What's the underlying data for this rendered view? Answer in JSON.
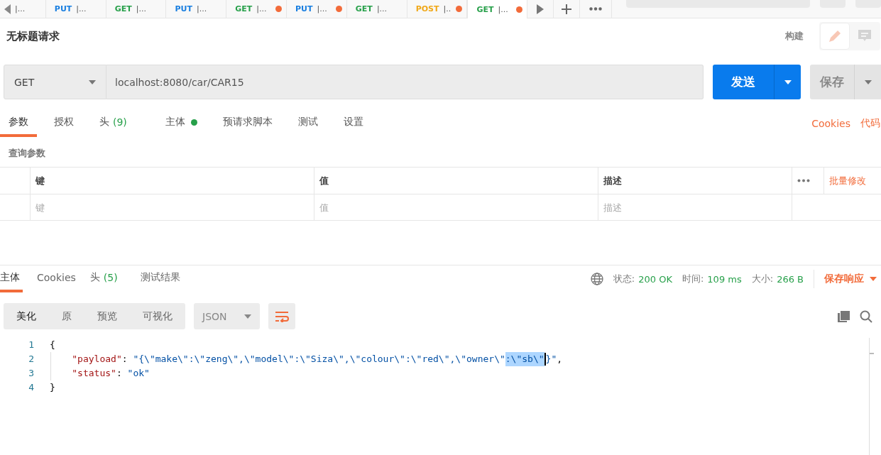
{
  "tabs": [
    {
      "label": "|...",
      "unsaved": false,
      "selected": false
    },
    {
      "method": "PUT",
      "color": "#1a7fe0",
      "label": "|...",
      "unsaved": false,
      "selected": false
    },
    {
      "method": "GET",
      "color": "#27a04a",
      "label": "|...",
      "unsaved": false,
      "selected": false
    },
    {
      "method": "PUT",
      "color": "#1a7fe0",
      "label": "|...",
      "unsaved": false,
      "selected": false
    },
    {
      "method": "GET",
      "color": "#27a04a",
      "label": "|...",
      "unsaved": true,
      "selected": false
    },
    {
      "method": "PUT",
      "color": "#1a7fe0",
      "label": "|...",
      "unsaved": true,
      "selected": false
    },
    {
      "method": "GET",
      "color": "#27a04a",
      "label": "|...",
      "unsaved": false,
      "selected": false
    },
    {
      "method": "POST",
      "color": "#f0a818",
      "label": "|..",
      "unsaved": true,
      "selected": false
    },
    {
      "method": "GET",
      "color": "#27a04a",
      "label": "|...",
      "unsaved": true,
      "selected": true
    }
  ],
  "request": {
    "title": "无标题请求",
    "build_label": "构建",
    "modes": [
      {
        "selected": true
      },
      {
        "selected": false
      }
    ],
    "method": "GET",
    "url": "localhost:8080/car/CAR15",
    "send": "发送",
    "save": "保存",
    "tabs": [
      {
        "label": "参数",
        "selected": true
      },
      {
        "label": "授权",
        "selected": false
      },
      {
        "label": "头",
        "count": "(9)",
        "selected": false
      },
      {
        "label": "主体",
        "dot": true,
        "selected": false
      },
      {
        "label": "预请求脚本",
        "selected": false
      },
      {
        "label": "测试",
        "selected": false
      },
      {
        "label": "设置",
        "selected": false
      }
    ],
    "links": [
      "Cookies",
      "代码"
    ],
    "params_title": "查询参数",
    "columns": [
      "键",
      "值",
      "描述"
    ],
    "bulk_edit": "批量修改",
    "placeholders": [
      "键",
      "值",
      "描述"
    ]
  },
  "response": {
    "tabs": [
      {
        "label": "主体",
        "selected": true
      },
      {
        "label": "Cookies",
        "selected": false
      },
      {
        "label": "头",
        "count": "(5)",
        "selected": false
      },
      {
        "label": "测试结果",
        "selected": false
      }
    ],
    "stats": [
      {
        "label": "状态:",
        "value": "200 OK"
      },
      {
        "label": "时间:",
        "value": "109 ms"
      },
      {
        "label": "大小:",
        "value": "266 B"
      }
    ],
    "save_response": "保存响应",
    "views": [
      {
        "label": "美化",
        "selected": true
      },
      {
        "label": "原",
        "selected": false
      },
      {
        "label": "预览",
        "selected": false
      },
      {
        "label": "可视化",
        "selected": false
      }
    ],
    "format": "JSON",
    "code": [
      {
        "number": "1",
        "tokens": [
          {
            "kind": "punct",
            "text": "{"
          }
        ]
      },
      {
        "number": "2",
        "tokens": [
          {
            "kind": "indent"
          },
          {
            "kind": "key",
            "text": "\"payload\""
          },
          {
            "kind": "punct",
            "text": ": "
          },
          {
            "kind": "string",
            "text": "\"{\\\"make\\\":\\\"zeng\\\",\\\"model\\\":\\\"Siza\\\",\\\"colour\\\":\\\"red\\\",\\\"owner\\\""
          },
          {
            "kind": "string",
            "text": ":\\\"sb\\\"",
            "selected": true
          },
          {
            "kind": "cursor"
          },
          {
            "kind": "string",
            "text": "}\""
          },
          {
            "kind": "punct",
            "text": ","
          }
        ]
      },
      {
        "number": "3",
        "tokens": [
          {
            "kind": "indent"
          },
          {
            "kind": "key",
            "text": "\"status\""
          },
          {
            "kind": "punct",
            "text": ": "
          },
          {
            "kind": "string",
            "text": "\"ok\""
          }
        ]
      },
      {
        "number": "4",
        "tokens": [
          {
            "kind": "punct",
            "text": "}"
          }
        ]
      }
    ]
  }
}
